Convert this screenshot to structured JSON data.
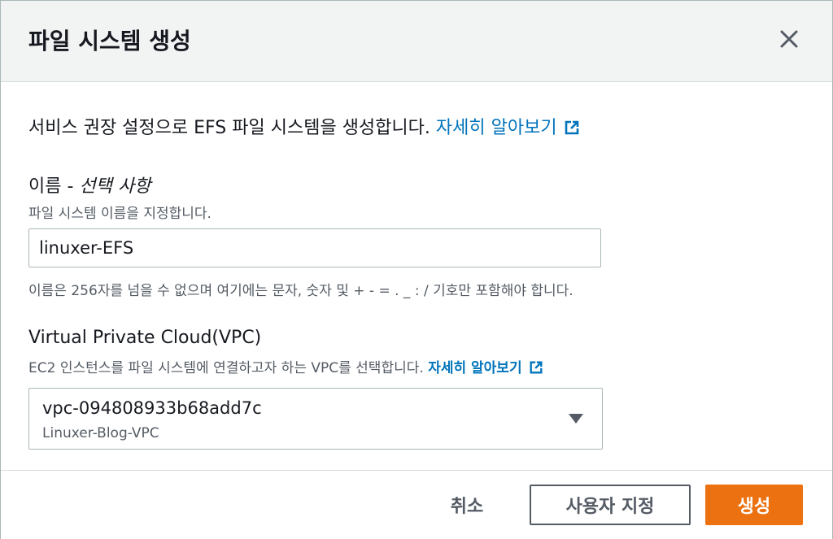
{
  "dialog": {
    "title": "파일 시스템 생성"
  },
  "intro": {
    "text": "서비스 권장 설정으로 EFS 파일 시스템을 생성합니다.",
    "learn_more": "자세히 알아보기"
  },
  "name_field": {
    "label": "이름 - ",
    "optional": "선택 사항",
    "description": "파일 시스템 이름을 지정합니다.",
    "value": "linuxer-EFS",
    "constraint": "이름은 256자를 넘을 수 없으며 여기에는 문자, 숫자 및 + - = . _ : / 기호만 포함해야 합니다."
  },
  "vpc_field": {
    "label": "Virtual Private Cloud(VPC)",
    "description": "EC2 인스턴스를 파일 시스템에 연결하고자 하는 VPC를 선택합니다.",
    "learn_more": "자세히 알아보기",
    "selected_id": "vpc-094808933b68add7c",
    "selected_name": "Linuxer-Blog-VPC"
  },
  "footer": {
    "cancel_label": "취소",
    "customize_label": "사용자 지정",
    "create_label": "생성"
  },
  "colors": {
    "link": "#0073bb",
    "primary": "#ec7211",
    "header_bg": "#f2f3f3"
  }
}
